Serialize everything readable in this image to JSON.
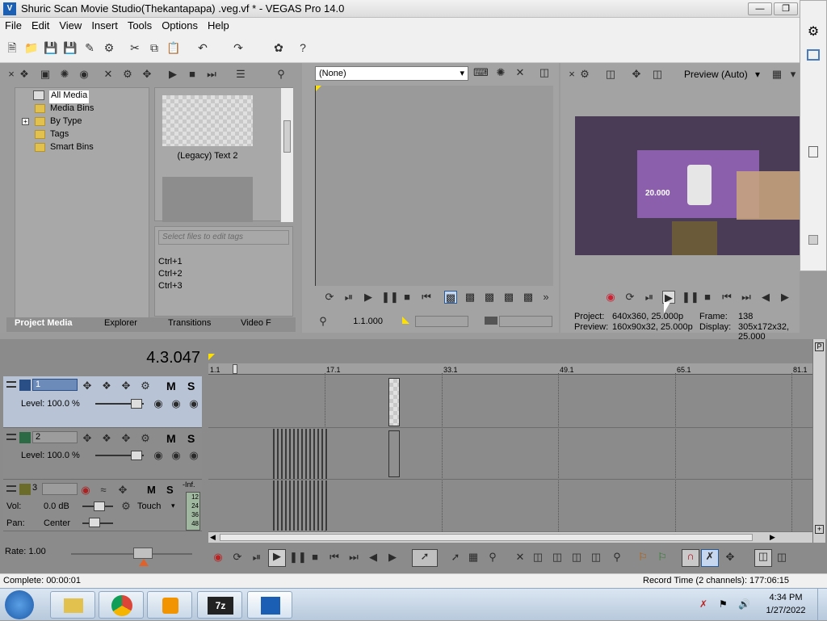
{
  "window": {
    "title": "Shuric Scan Movie Studio(Thekantapapa) .veg.vf * - VEGAS Pro 14.0"
  },
  "menu": [
    "File",
    "Edit",
    "View",
    "Insert",
    "Tools",
    "Options",
    "Help"
  ],
  "media_tree": [
    "All Media",
    "Media Bins",
    "By Type",
    "Tags",
    "Smart Bins"
  ],
  "media_item": "(Legacy) Text 2",
  "tag_placeholder": "Select files to edit tags",
  "shortcuts": [
    "Ctrl+1",
    "Ctrl+2",
    "Ctrl+3"
  ],
  "tabs": [
    "Project Media",
    "Explorer",
    "Transitions",
    "Video F"
  ],
  "trimmer": {
    "select": "(None)",
    "time": "1.1.000"
  },
  "preview": {
    "mode": "Preview (Auto)",
    "project_label": "Project:",
    "project_value": "640x360, 25.000p",
    "preview_label": "Preview:",
    "preview_value": "160x90x32, 25.000p",
    "frame_label": "Frame:",
    "frame_value": "138",
    "display_label": "Display:",
    "display_value": "305x172x32, 25.000",
    "overlay_text": "20.000"
  },
  "timeline": {
    "position": "4.3.047",
    "ruler": [
      "1.1",
      "17.1",
      "33.1",
      "49.1",
      "65.1",
      "81.1"
    ],
    "tracks": [
      {
        "num": "1",
        "level_label": "Level: 100.0 %",
        "m": "M",
        "s": "S"
      },
      {
        "num": "2",
        "level_label": "Level: 100.0 %",
        "m": "M",
        "s": "S"
      },
      {
        "num": "3",
        "vol_label": "Vol:",
        "vol_value": "0.0 dB",
        "pan_label": "Pan:",
        "pan_value": "Center",
        "touch": "Touch",
        "m": "M",
        "s": "S",
        "meter_inf": "-Inf.",
        "meter_ticks": [
          "12",
          "24",
          "36",
          "48"
        ]
      }
    ],
    "rate": "Rate: 1.00"
  },
  "status": {
    "complete": "Complete: 00:00:01",
    "record": "Record Time (2 channels): 177:06:15"
  },
  "taskbar": {
    "time": "4:34 PM",
    "date": "1/27/2022"
  }
}
